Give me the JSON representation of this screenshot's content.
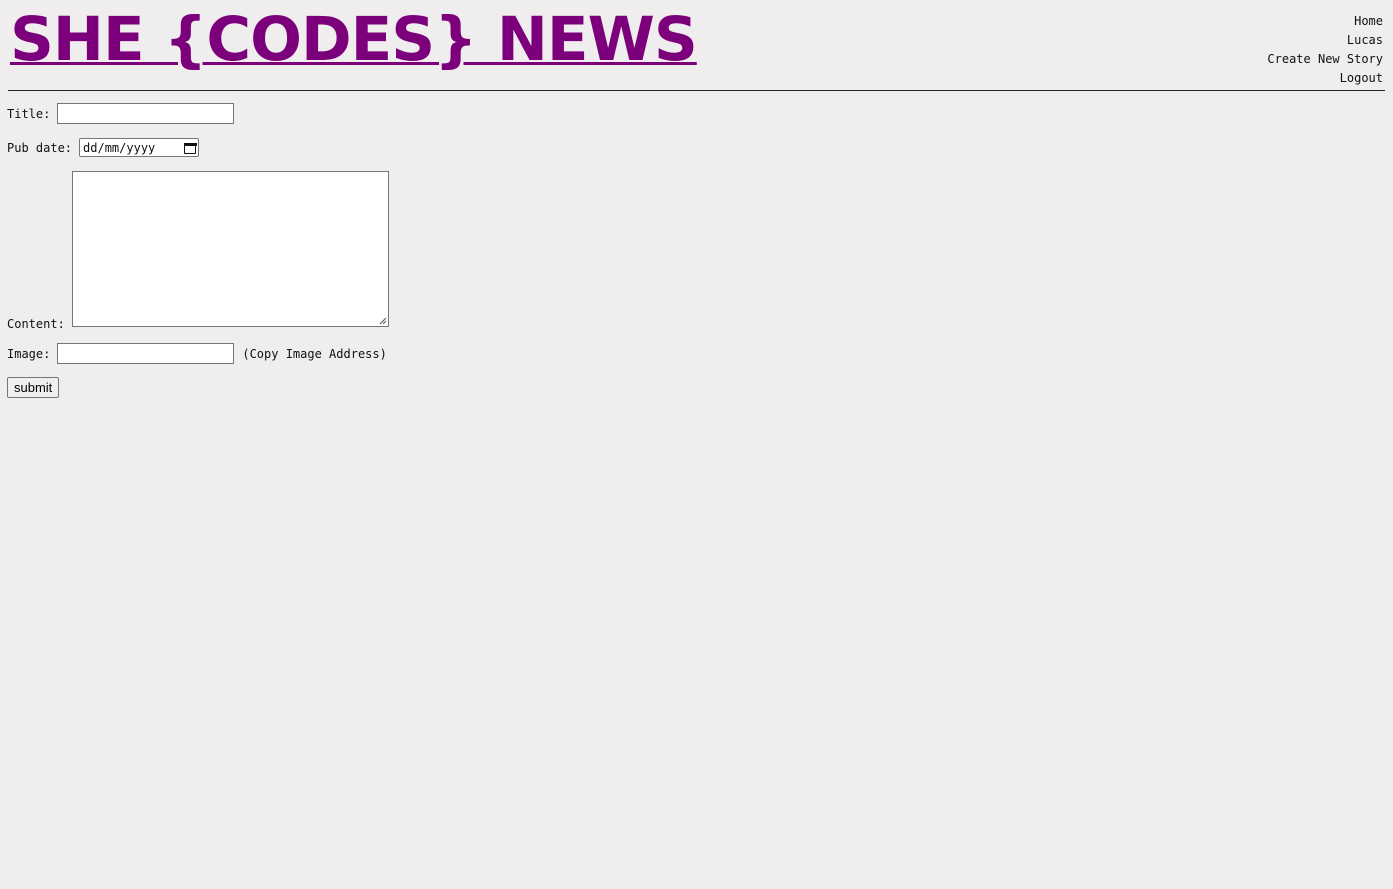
{
  "site": {
    "title": "SHE {CODES} NEWS",
    "title_color": "#7c007c"
  },
  "nav": {
    "items": [
      {
        "label": "Home"
      },
      {
        "label": "Lucas"
      },
      {
        "label": "Create New Story"
      },
      {
        "label": "Logout"
      }
    ]
  },
  "form": {
    "title_label": "Title:",
    "title_value": "",
    "pub_date_label": "Pub date:",
    "pub_date_placeholder": "dd/mm/yyyy",
    "pub_date_icon": "calendar-icon",
    "content_label": "Content:",
    "content_value": "",
    "image_label": "Image:",
    "image_value": "",
    "image_hint": "(Copy Image Address)",
    "submit_label": "submit"
  },
  "colors": {
    "background": "#efedee",
    "accent": "#7c007c"
  }
}
